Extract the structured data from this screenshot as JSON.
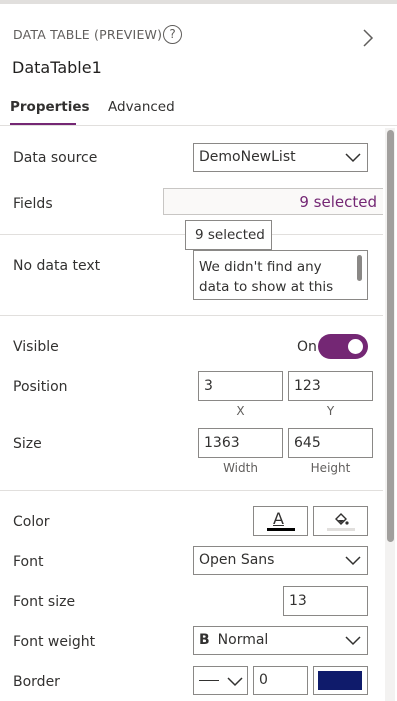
{
  "header": {
    "category": "DATA TABLE (PREVIEW)",
    "help_icon": "help-circle-icon",
    "collapse_icon": "chevron-right-icon",
    "control_name": "DataTable1"
  },
  "tabs": [
    {
      "label": "Properties",
      "active": true
    },
    {
      "label": "Advanced",
      "active": false
    }
  ],
  "accent_color": "#742774",
  "properties": {
    "data_source": {
      "label": "Data source",
      "value": "DemoNewList"
    },
    "fields": {
      "label": "Fields",
      "value": "9 selected",
      "tooltip": "9 selected"
    },
    "no_data_text": {
      "label": "No data text",
      "value": "We didn't find any data to show at this"
    },
    "visible": {
      "label": "Visible",
      "state": "On",
      "on": true
    },
    "position": {
      "label": "Position",
      "x": "3",
      "y": "123",
      "x_caption": "X",
      "y_caption": "Y"
    },
    "size": {
      "label": "Size",
      "width": "1363",
      "height": "645",
      "width_caption": "Width",
      "height_caption": "Height"
    },
    "color": {
      "label": "Color",
      "text_color_glyph": "A",
      "text_color_icon": "font-color-icon",
      "fill_icon": "paint-bucket-icon"
    },
    "font": {
      "label": "Font",
      "value": "Open Sans"
    },
    "font_size": {
      "label": "Font size",
      "value": "13"
    },
    "font_weight": {
      "label": "Font weight",
      "glyph": "B",
      "value": "Normal"
    },
    "border": {
      "label": "Border",
      "style_icon": "line-style-icon",
      "thickness": "0",
      "color": "#0f1b6b"
    }
  }
}
